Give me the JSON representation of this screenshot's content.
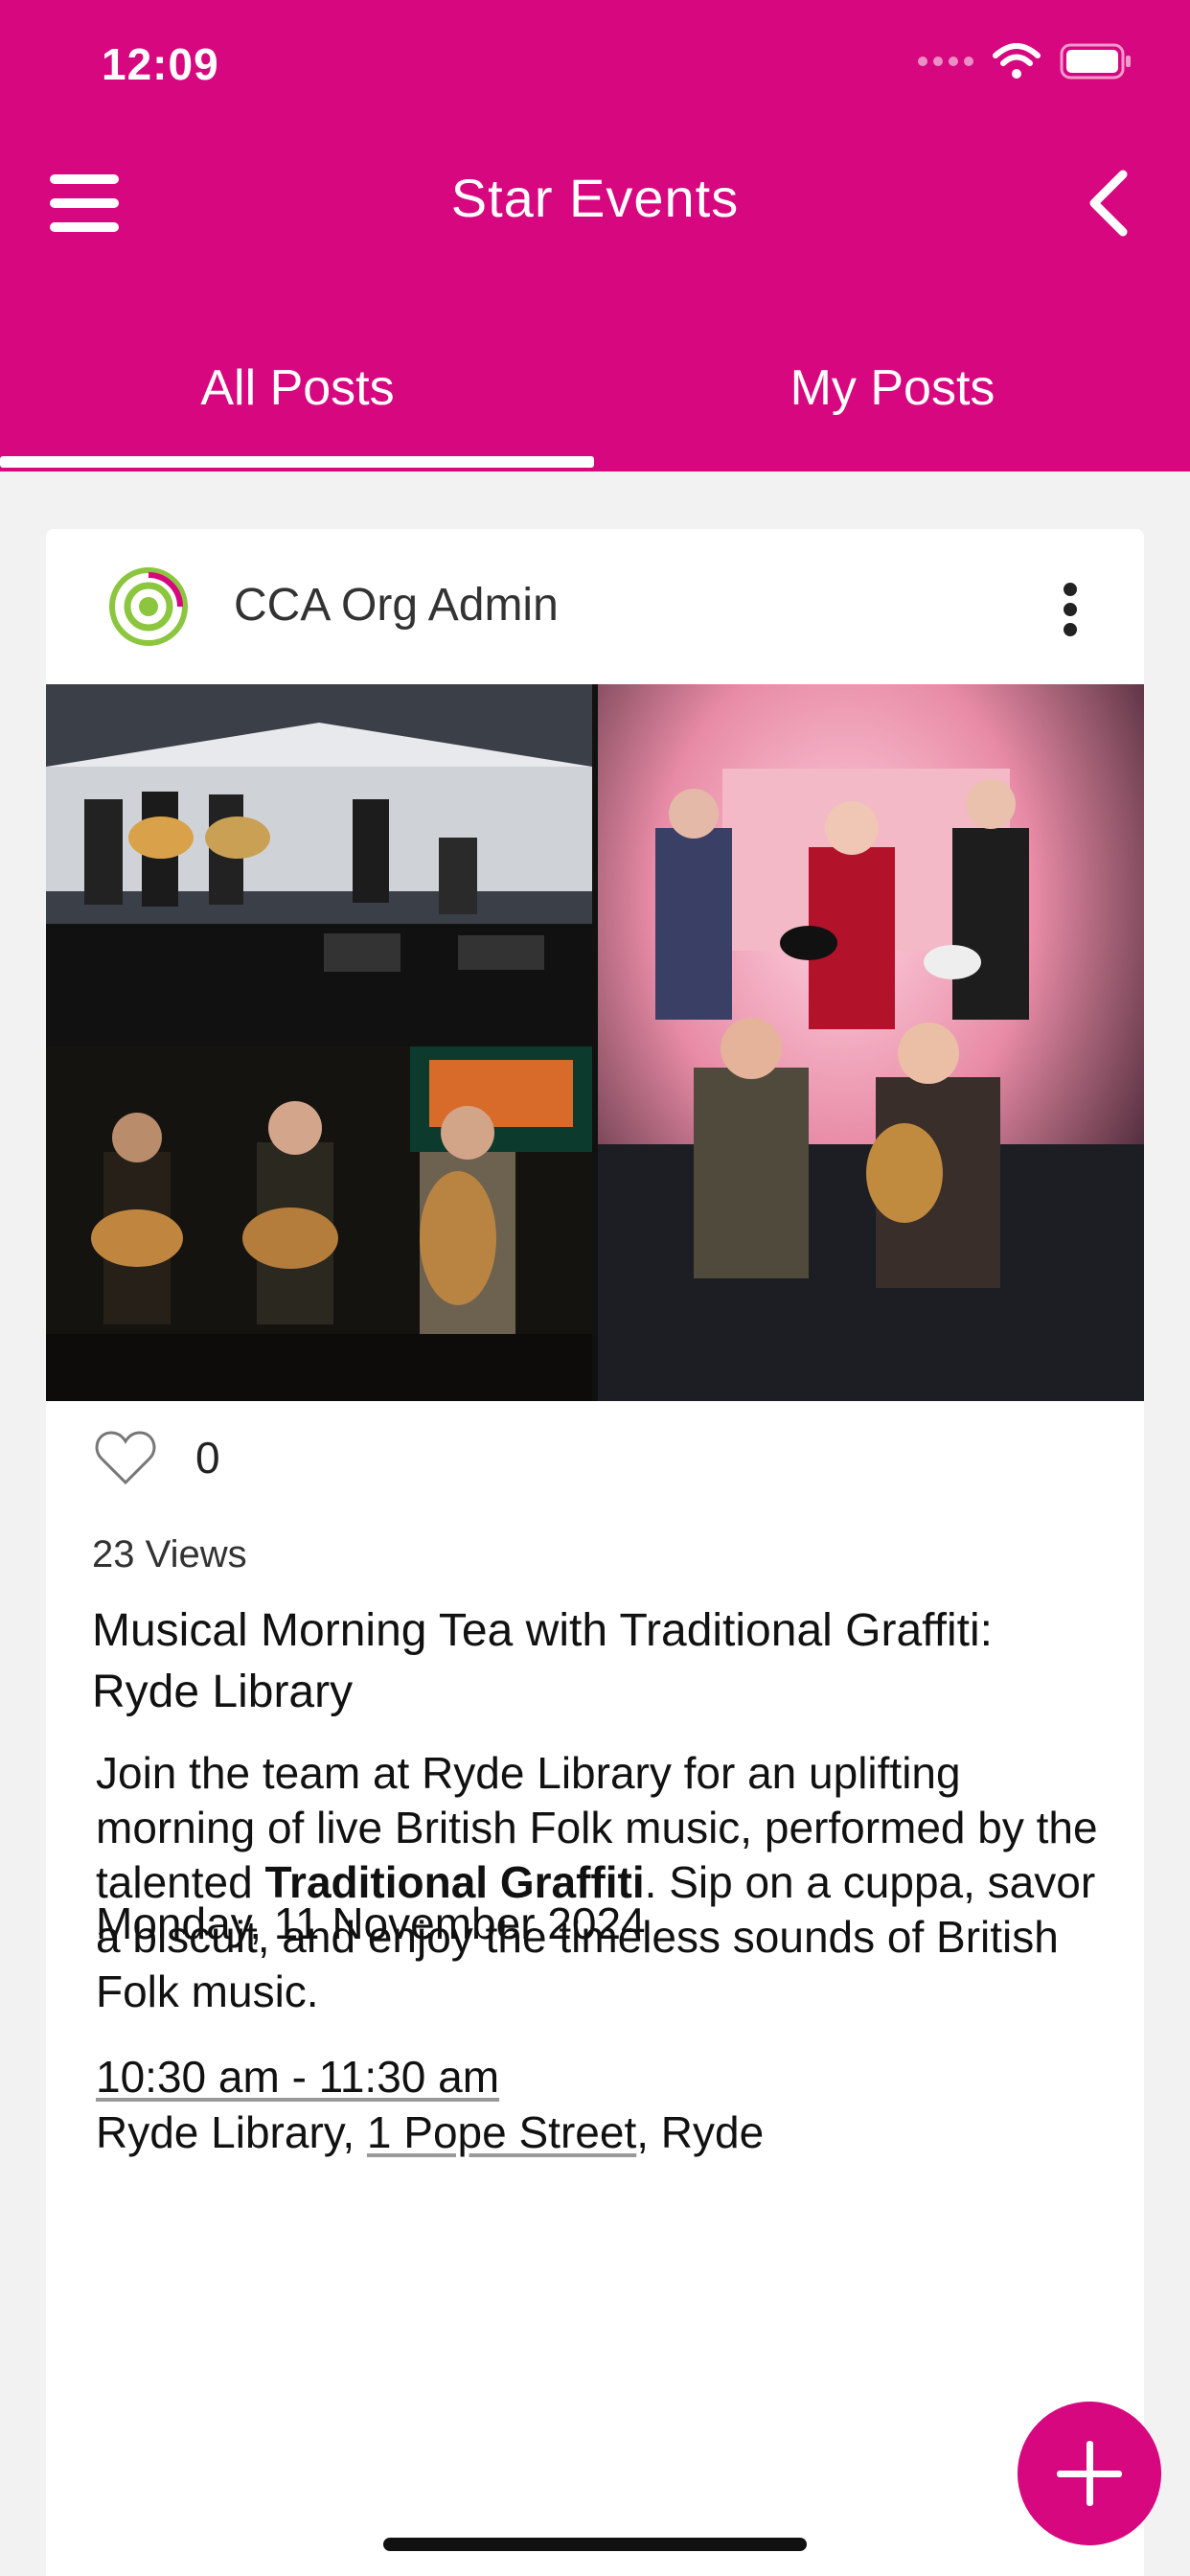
{
  "status_bar": {
    "time": "12:09"
  },
  "header": {
    "title": "Star Events"
  },
  "tabs": [
    {
      "label": "All Posts",
      "active": true
    },
    {
      "label": "My Posts",
      "active": false
    }
  ],
  "post": {
    "author": "CCA Org Admin",
    "like_count": "0",
    "views": "23 Views",
    "title": "Musical Morning Tea with Traditional Graffiti: Ryde Library",
    "body_before": "Join the team at Ryde Library for an uplifting morning of live British Folk music, performed by the talented ",
    "body_bold": "Traditional Graffiti",
    "body_after": ". Sip on a cuppa, savor a biscuit, and enjoy the timeless sounds of British Folk music.",
    "date": "Monday, 11 November 2024",
    "time": "10:30 am - 11:30 am",
    "location_prefix": "Ryde Library, ",
    "location_street": "1 Pope Street",
    "location_suffix": ", Ryde"
  },
  "colors": {
    "brand": "#d6077f"
  },
  "icons": [
    "menu-icon",
    "back-chevron-icon",
    "more-vertical-icon",
    "heart-outline-icon",
    "plus-icon",
    "wifi-icon",
    "battery-icon"
  ]
}
